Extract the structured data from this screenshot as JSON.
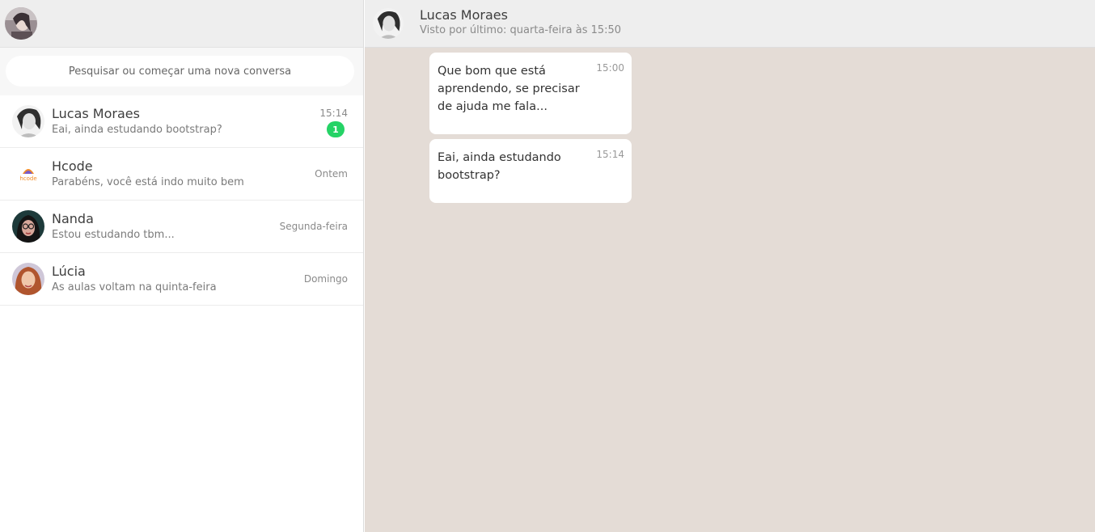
{
  "sidebar": {
    "search": {
      "placeholder": "Pesquisar ou começar uma nova conversa"
    },
    "contacts": [
      {
        "name": "Lucas Moraes",
        "preview": "Eai, ainda estudando bootstrap?",
        "time": "15:14",
        "unread": "1"
      },
      {
        "name": "Hcode",
        "preview": "Parabéns, você está indo muito bem",
        "time": "Ontem",
        "avatar_text": "hcode"
      },
      {
        "name": "Nanda",
        "preview": "Estou estudando tbm...",
        "time": "Segunda-feira"
      },
      {
        "name": "Lúcia",
        "preview": "As aulas voltam na quinta-feira",
        "time": "Domingo"
      }
    ]
  },
  "chat": {
    "name": "Lucas Moraes",
    "status": "Visto por último: quarta-feira às 15:50",
    "messages": [
      {
        "text": "Que bom que está aprendendo, se precisar de ajuda me fala...",
        "time": "15:00"
      },
      {
        "text": "Eai, ainda estudando bootstrap?",
        "time": "15:14"
      }
    ]
  },
  "colors": {
    "chat_background": "#e4dcd6",
    "header_background": "#eeeeee",
    "unread_badge": "#25d366"
  }
}
